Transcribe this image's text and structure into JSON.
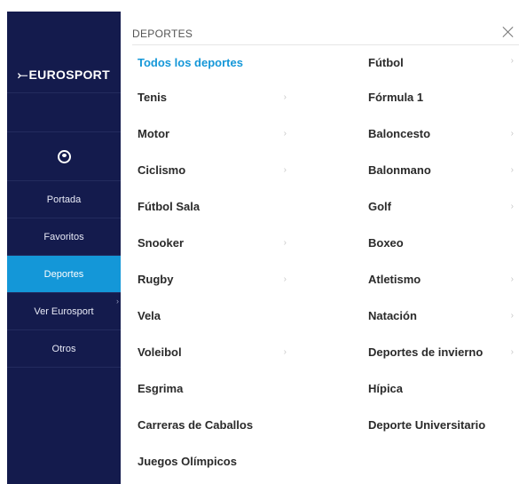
{
  "brand": {
    "logo_mark": "⤚",
    "logo_text": "EUROSPORT"
  },
  "sidebar": {
    "user_icon": "user-circle-icon",
    "items": [
      {
        "label": "Portada",
        "active": false
      },
      {
        "label": "Favoritos",
        "active": false
      },
      {
        "label": "Deportes",
        "active": true
      },
      {
        "label": "Ver Eurosport",
        "active": false
      },
      {
        "label": "Otros",
        "active": false
      }
    ]
  },
  "panel": {
    "heading": "DEPORTES",
    "left_column": [
      {
        "label": "Todos los deportes",
        "chevron": "",
        "highlight": true
      },
      {
        "label": "Tenis",
        "chevron": "›"
      },
      {
        "label": "Motor",
        "chevron": "›"
      },
      {
        "label": "Ciclismo",
        "chevron": "›"
      },
      {
        "label": "Fútbol Sala",
        "chevron": ""
      },
      {
        "label": "Snooker",
        "chevron": "›"
      },
      {
        "label": "Rugby",
        "chevron": "›"
      },
      {
        "label": "Vela",
        "chevron": ""
      },
      {
        "label": "Voleibol",
        "chevron": "›"
      },
      {
        "label": "Esgrima",
        "chevron": ""
      },
      {
        "label": "Carreras de Caballos",
        "chevron": ""
      },
      {
        "label": "Juegos Olímpicos",
        "chevron": ""
      }
    ],
    "right_column": [
      {
        "label": "Fútbol",
        "chevron": "›"
      },
      {
        "label": "Fórmula 1",
        "chevron": ""
      },
      {
        "label": "Baloncesto",
        "chevron": "›"
      },
      {
        "label": "Balonmano",
        "chevron": "›"
      },
      {
        "label": "Golf",
        "chevron": "›"
      },
      {
        "label": "Boxeo",
        "chevron": ""
      },
      {
        "label": "Atletismo",
        "chevron": "›"
      },
      {
        "label": "Natación",
        "chevron": "›"
      },
      {
        "label": "Deportes de invierno",
        "chevron": "›"
      },
      {
        "label": "Hípica",
        "chevron": ""
      },
      {
        "label": "Deporte Universitario",
        "chevron": ""
      }
    ]
  },
  "colors": {
    "sidebar_bg": "#141b4d",
    "accent": "#1497d8",
    "text": "#2a2a2a"
  }
}
